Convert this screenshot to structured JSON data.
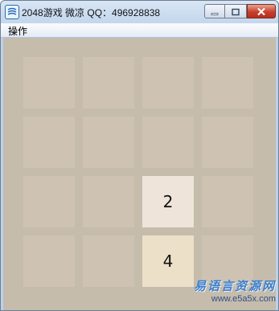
{
  "window": {
    "title": "2048游戏 微凉 QQ：496928838",
    "icon": "app-grid-icon",
    "controls": [
      "minimize-icon",
      "maximize-icon",
      "close-icon"
    ]
  },
  "menu": {
    "items": [
      {
        "label": "操作"
      }
    ]
  },
  "board": {
    "rows": [
      [
        "",
        "",
        "",
        ""
      ],
      [
        "",
        "",
        "",
        ""
      ],
      [
        "",
        "",
        "2",
        ""
      ],
      [
        "",
        "",
        "4",
        ""
      ]
    ],
    "colors": {
      "background": "#c5bcac",
      "empty": "#cec3b3",
      "tile_2": "#eee4da",
      "tile_4": "#ede0c8"
    }
  },
  "watermark": {
    "name": "易语言资源网",
    "url": "www.e5a5x.com"
  }
}
